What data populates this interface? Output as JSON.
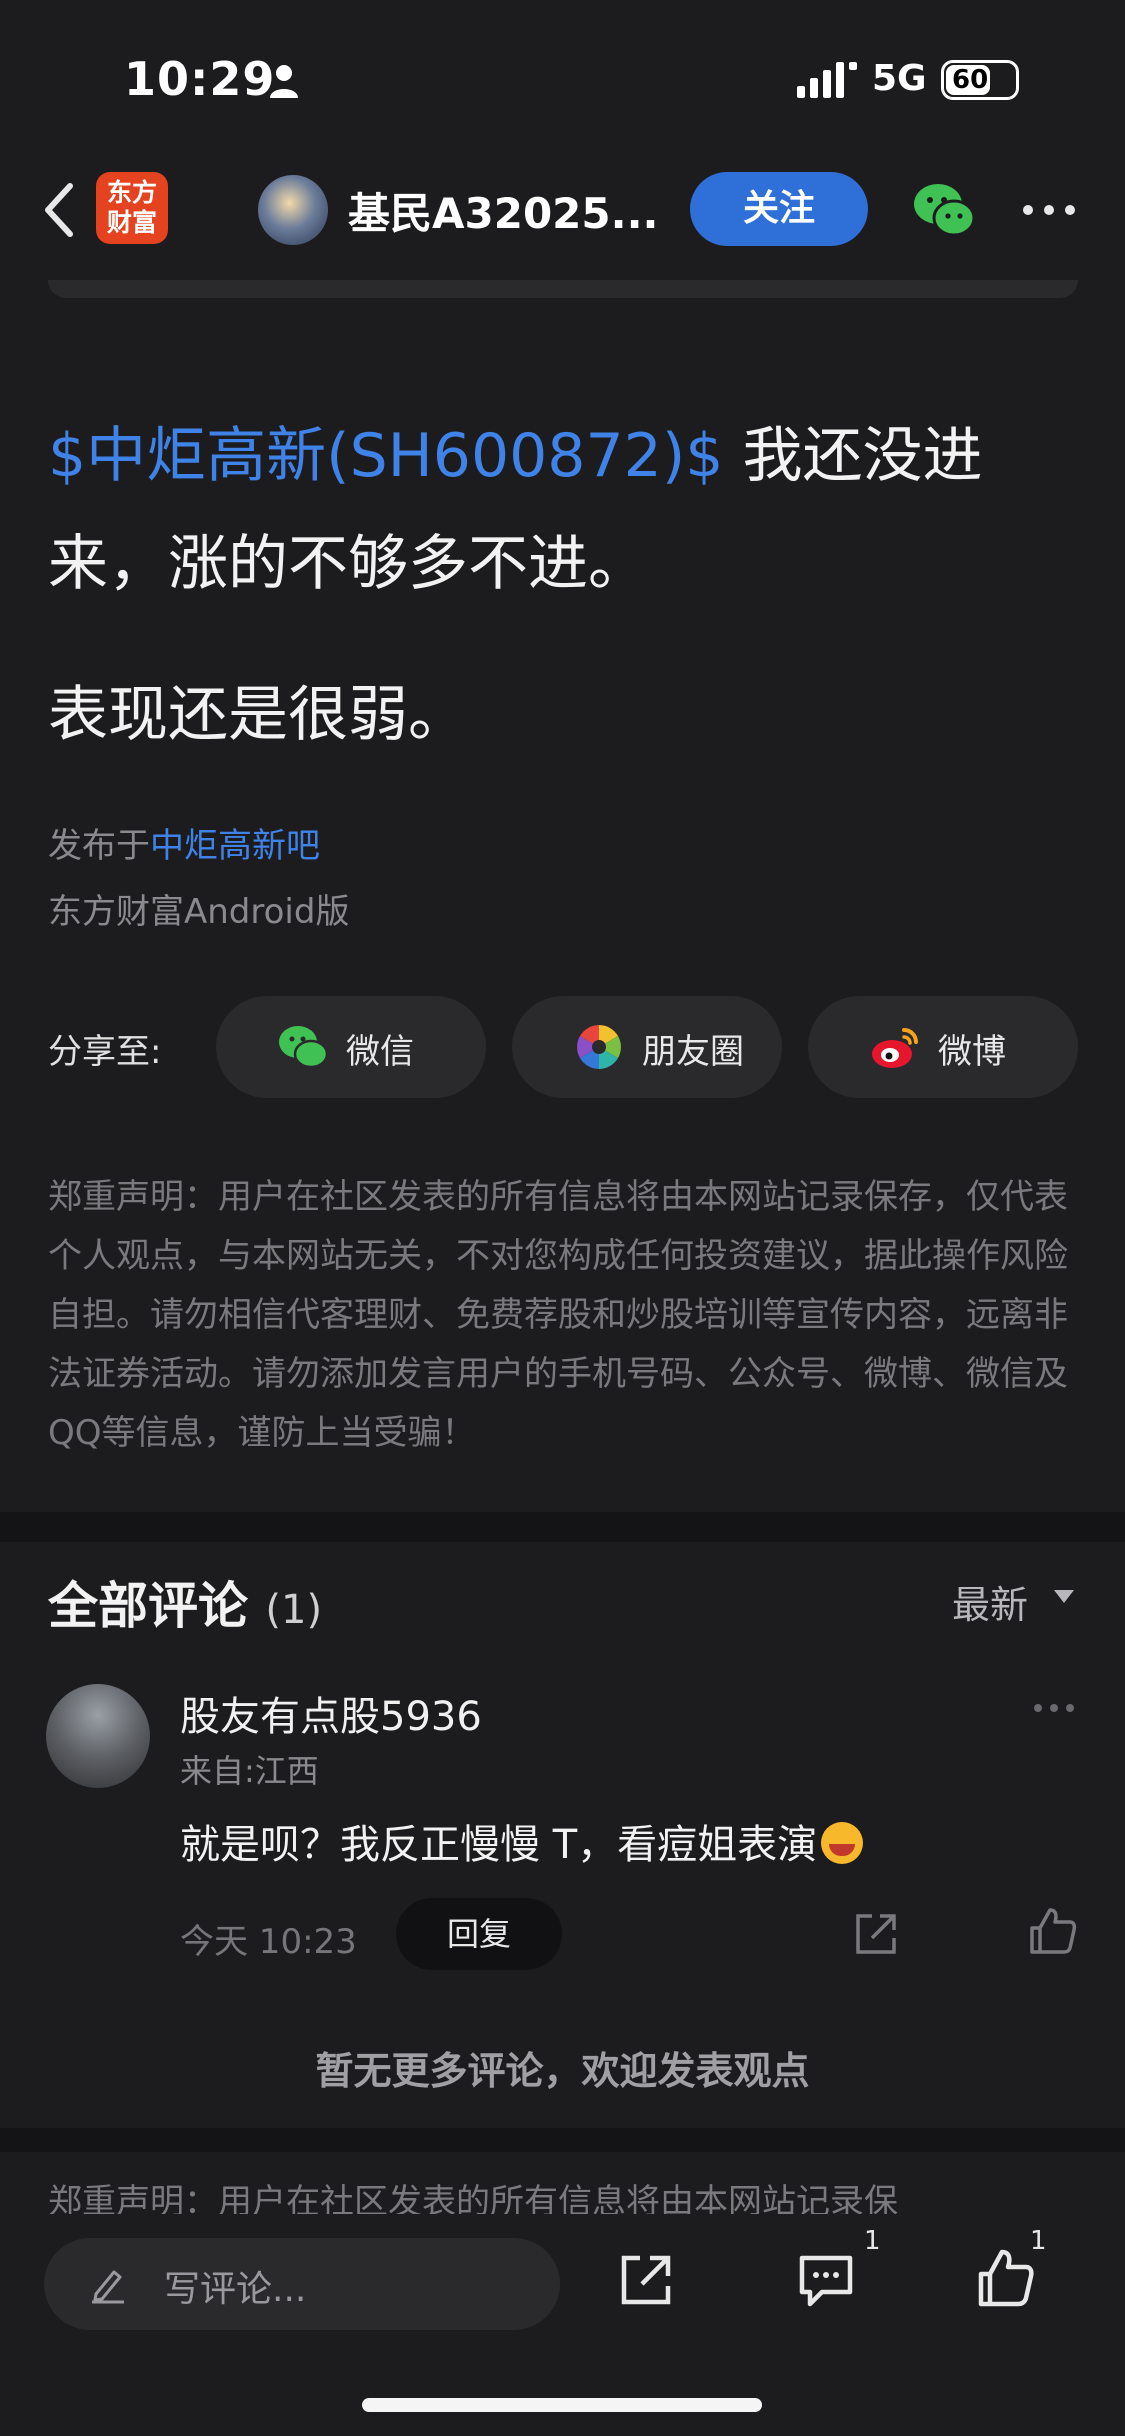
{
  "status_bar": {
    "time": "10:29",
    "network": "5G",
    "battery": "60"
  },
  "nav": {
    "logo_line1": "东方",
    "logo_line2": "财富",
    "username": "基民A32025...",
    "follow_label": "关注"
  },
  "post": {
    "stock_tag": "$中炬高新(SH600872)$",
    "text_part1": " 我还没进来，涨的不够多不进。",
    "text_part2": "表现还是很弱。",
    "published_prefix": "发布于",
    "published_bar": "中炬高新吧",
    "source": "东方财富Android版"
  },
  "share": {
    "label": "分享至:",
    "items": [
      {
        "label": "微信",
        "icon": "wechat-icon"
      },
      {
        "label": "朋友圈",
        "icon": "moments-icon"
      },
      {
        "label": "微博",
        "icon": "weibo-icon"
      }
    ]
  },
  "disclaimer": "郑重声明：用户在社区发表的所有信息将由本网站记录保存，仅代表个人观点，与本网站无关，不对您构成任何投资建议，据此操作风险自担。请勿相信代客理财、免费荐股和炒股培训等宣传内容，远离非法证券活动。请勿添加发言用户的手机号码、公众号、微博、微信及QQ等信息，谨防上当受骗！",
  "comments": {
    "title": "全部评论",
    "count": "(1)",
    "sort": "最新",
    "items": [
      {
        "name": "股友有点股5936",
        "location": "来自:江西",
        "text": "就是呗？我反正慢慢 T，看痘姐表演",
        "time": "今天 10:23",
        "reply_label": "回复"
      }
    ],
    "no_more": "暂无更多评论，欢迎发表观点"
  },
  "disclaimer_footer": "郑重声明：用户在社区发表的所有信息将由本网站记录保",
  "bottom_bar": {
    "input_placeholder": "写评论...",
    "comment_count": "1",
    "like_count": "1"
  },
  "colors": {
    "accent_blue": "#2f6fd8",
    "link_blue": "#3f82e8",
    "logo_red": "#e5421f",
    "background": "#1c1c1e"
  }
}
